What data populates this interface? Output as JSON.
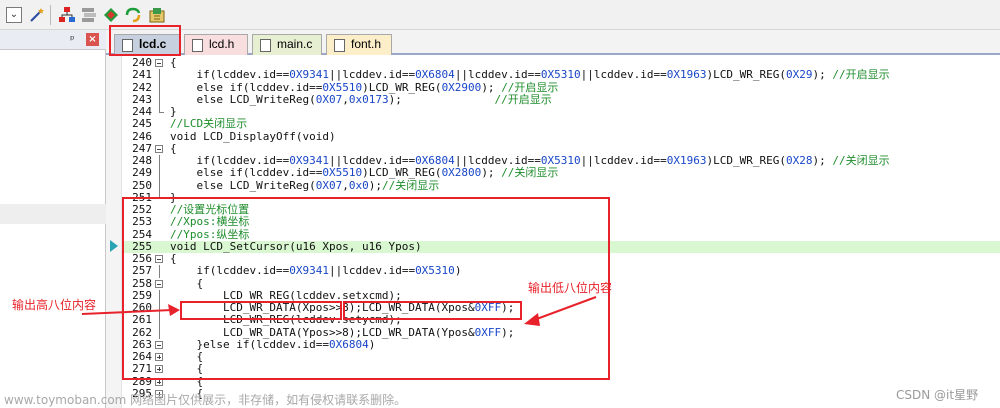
{
  "toolbar": {
    "dropdown_glyph": "⌄",
    "icons": [
      "dropdown-icon",
      "magic-wand-icon",
      "tree-add-icon",
      "window-list-icon",
      "green-diamond-icon",
      "refresh-icon",
      "build-icon"
    ]
  },
  "left_panel": {
    "pin_glyph": "ᵖ",
    "close_glyph": "×"
  },
  "tabs": [
    {
      "label": "lcd.c",
      "active": true
    },
    {
      "label": "lcd.h",
      "active": false
    },
    {
      "label": "main.c",
      "active": false
    },
    {
      "label": "font.h",
      "active": false
    }
  ],
  "lines": [
    {
      "no": "240",
      "fold": "box",
      "code": "{"
    },
    {
      "no": "241",
      "fold": "vline",
      "code": "    if(lcddev.id==0X9341||lcddev.id==0X6804||lcddev.id==0X5310||lcddev.id==0X1963)LCD_WR_REG(0X29); //开启显示"
    },
    {
      "no": "242",
      "fold": "vline",
      "code": "    else if(lcddev.id==0X5510)LCD_WR_REG(0X2900); //开启显示"
    },
    {
      "no": "243",
      "fold": "vline",
      "code": "    else LCD_WriteReg(0X07,0x0173);              //开启显示"
    },
    {
      "no": "244",
      "fold": "endl",
      "code": "}"
    },
    {
      "no": "245",
      "fold": "",
      "code": "//LCD关闭显示"
    },
    {
      "no": "246",
      "fold": "",
      "code": "void LCD_DisplayOff(void)"
    },
    {
      "no": "247",
      "fold": "box",
      "code": "{"
    },
    {
      "no": "248",
      "fold": "vline",
      "code": "    if(lcddev.id==0X9341||lcddev.id==0X6804||lcddev.id==0X5310||lcddev.id==0X1963)LCD_WR_REG(0X28); //关闭显示"
    },
    {
      "no": "249",
      "fold": "vline",
      "code": "    else if(lcddev.id==0X5510)LCD_WR_REG(0X2800); //关闭显示"
    },
    {
      "no": "250",
      "fold": "vline",
      "code": "    else LCD_WriteReg(0X07,0x0);//关闭显示"
    },
    {
      "no": "251",
      "fold": "endl",
      "code": "}"
    },
    {
      "no": "252",
      "fold": "",
      "code": "//设置光标位置"
    },
    {
      "no": "253",
      "fold": "",
      "code": "//Xpos:横坐标"
    },
    {
      "no": "254",
      "fold": "",
      "code": "//Ypos:纵坐标"
    },
    {
      "no": "255",
      "fold": "",
      "code": "void LCD_SetCursor(u16 Xpos, u16 Ypos)",
      "highlight": true
    },
    {
      "no": "256",
      "fold": "box",
      "code": "{"
    },
    {
      "no": "257",
      "fold": "vline",
      "code": "    if(lcddev.id==0X9341||lcddev.id==0X5310)"
    },
    {
      "no": "258",
      "fold": "box",
      "code": "    {"
    },
    {
      "no": "259",
      "fold": "vline",
      "code": "        LCD_WR_REG(lcddev.setxcmd);"
    },
    {
      "no": "260",
      "fold": "vline",
      "code": "        LCD_WR_DATA(Xpos>>8);LCD_WR_DATA(Xpos&0XFF);"
    },
    {
      "no": "261",
      "fold": "vline",
      "code": "        LCD_WR_REG(lcddev.setycmd);"
    },
    {
      "no": "262",
      "fold": "vline",
      "code": "        LCD_WR_DATA(Ypos>>8);LCD_WR_DATA(Ypos&0XFF);"
    },
    {
      "no": "263",
      "fold": "box",
      "code": "    }else if(lcddev.id==0X6804)"
    },
    {
      "no": "264",
      "fold": "plus",
      "code": "    {"
    },
    {
      "no": "271",
      "fold": "plus",
      "code": "    {"
    },
    {
      "no": "289",
      "fold": "plus",
      "code": "    {"
    },
    {
      "no": "295",
      "fold": "plus",
      "code": "    {"
    }
  ],
  "annotations": {
    "left_note": "输出高八位内容",
    "right_note": "输出低八位内容"
  },
  "watermarks": {
    "left": "www.toymoban.com 网络图片仅供展示，非存储，如有侵权请联系删除。",
    "right": "CSDN @it星野"
  },
  "colors": {
    "annotation_red": "#e8222a",
    "comment_green": "#1e8d2c",
    "number_blue": "#1846c8",
    "current_line": "#d9f7d0"
  }
}
